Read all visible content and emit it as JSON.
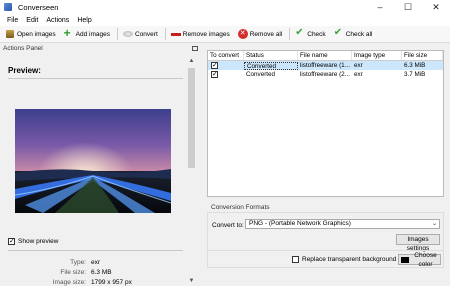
{
  "window": {
    "title": "Converseen",
    "controls": [
      "–",
      "☐",
      "✕"
    ]
  },
  "menu": [
    "File",
    "Edit",
    "Actions",
    "Help"
  ],
  "toolbar": {
    "open": "Open images",
    "add": "Add images",
    "convert": "Convert",
    "remove": "Remove images",
    "remove_all": "Remove all",
    "check": "Check",
    "check_all": "Check all"
  },
  "actions_panel": {
    "title": "Actions Panel",
    "preview_title": "Preview:",
    "show_preview_label": "Show preview",
    "show_preview_checked": true,
    "info": [
      {
        "key": "Type:",
        "value": "exr"
      },
      {
        "key": "File size:",
        "value": "6.3 MB"
      },
      {
        "key": "Image size:",
        "value": "1799 x 957 px"
      }
    ]
  },
  "table": {
    "headers": [
      "To convert",
      "Status",
      "File name",
      "Image type",
      "File size"
    ],
    "rows": [
      {
        "checked": true,
        "status": "Converted",
        "file_name": "listoffreeware (1...",
        "type": "exr",
        "size": "6.3 MiB",
        "selected": true
      },
      {
        "checked": true,
        "status": "Converted",
        "file_name": "listoffreeware (2...",
        "type": "exr",
        "size": "3.7 MiB",
        "selected": false
      }
    ]
  },
  "conversion": {
    "section_title": "Conversion Formats",
    "convert_to_label": "Convert to:",
    "selected_format": "PNG - (Portable Network Graphics)",
    "image_settings": "Images settings",
    "replace_bg_label": "Replace transparent background",
    "replace_bg_checked": false,
    "choose_color": "Choose color",
    "color": "#000000"
  }
}
